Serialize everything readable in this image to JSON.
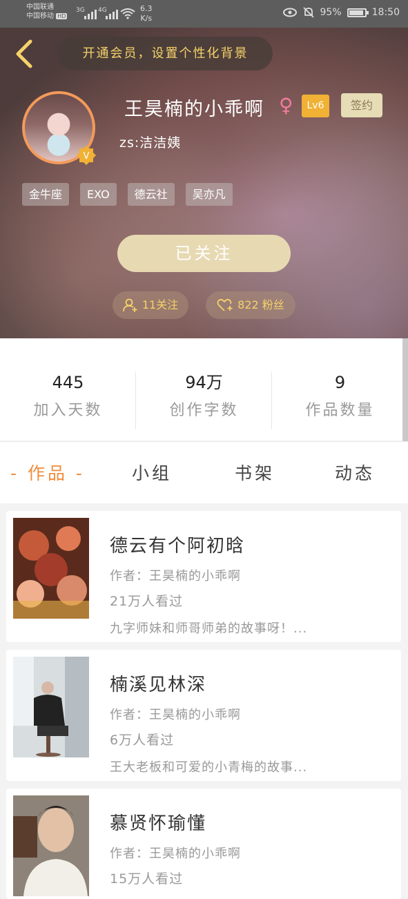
{
  "status_bar": {
    "carrier_1": "中国联通",
    "carrier_2": "中国移动",
    "hd_badge": "HD",
    "net_1": "3G",
    "net_2": "4G",
    "speed_value": "6.3",
    "speed_unit": "K/s",
    "battery": "95%",
    "time": "18:50"
  },
  "header": {
    "vip_prompt": "开通会员，设置个性化背景",
    "username": "王昊楠的小乖啊",
    "gender_symbol": "♀",
    "level": "Lv6",
    "sign_label": "签约",
    "bio": "zs:洁洁姨",
    "tags": [
      "金牛座",
      "EXO",
      "德云社",
      "吴亦凡"
    ],
    "follow_button": "已关注",
    "following_label": "11关注",
    "fans_label": "822 粉丝"
  },
  "stats": [
    {
      "value": "445",
      "label": "加入天数"
    },
    {
      "value": "94万",
      "label": "创作字数"
    },
    {
      "value": "9",
      "label": "作品数量"
    }
  ],
  "tabs": {
    "active": "- 作品 -",
    "items": [
      "小组",
      "书架",
      "动态"
    ]
  },
  "works": [
    {
      "title": "德云有个阿初晗",
      "author": "作者：王昊楠的小乖啊",
      "views": "21万人看过",
      "desc": "九字师妹和师哥师弟的故事呀！..."
    },
    {
      "title": "楠溪见林深",
      "author": "作者：王昊楠的小乖啊",
      "views": "6万人看过",
      "desc": "王大老板和可爱的小青梅的故事..."
    },
    {
      "title": "慕贤怀瑜懂",
      "author": "作者：王昊楠的小乖啊",
      "views": "15万人看过",
      "desc": ""
    }
  ],
  "colors": {
    "accent": "#f28c3a",
    "vip_text": "#f5d26a",
    "follow_bg": "#e7d9b2",
    "level_bg": "#f0b135"
  },
  "icons": [
    "back-chevron-icon",
    "wifi-icon",
    "eye-icon",
    "mute-bell-icon",
    "battery-icon",
    "verified-v-icon",
    "female-icon",
    "add-user-icon",
    "heart-icon"
  ]
}
